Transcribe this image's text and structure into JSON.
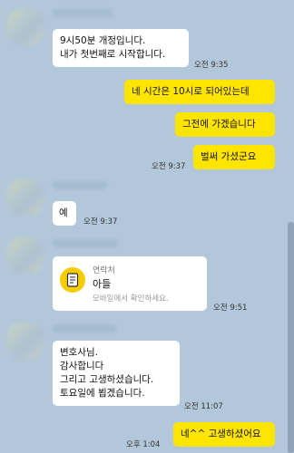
{
  "chat": {
    "messages": [
      {
        "direction": "in",
        "text": "9시50분 개정입니다.\n내가 첫번째로 시작합니다.",
        "time": "오전 9:35"
      },
      {
        "direction": "out",
        "text": "네 시간은 10시로 되어있는데",
        "time": ""
      },
      {
        "direction": "out",
        "text": "그전에 가겠습니다",
        "time": ""
      },
      {
        "direction": "out",
        "text": "벌써 가셨군요",
        "time": "오전 9:37"
      },
      {
        "direction": "in",
        "text": "예",
        "time": "오전 9:37"
      },
      {
        "direction": "in",
        "type": "contact",
        "contact_label": "연락처",
        "contact_name": "아들",
        "contact_note": "모바일에서 확인하세요.",
        "time": "오전 9:51"
      },
      {
        "direction": "in",
        "text": "변호사님.\n감사합니다\n그리고 고생하셨습니다.\n토요일에 뵙겠습니다.",
        "time": "오전 11:07"
      },
      {
        "direction": "out",
        "text": "네^^ 고생하셨어요",
        "time": "오후 1:04"
      }
    ]
  },
  "icons": {
    "contact": "contact-card-icon"
  },
  "colors": {
    "background": "#b2c7d9",
    "incoming_bubble": "#ffffff",
    "outgoing_bubble": "#fee500",
    "contact_icon": "#f5cc00"
  }
}
